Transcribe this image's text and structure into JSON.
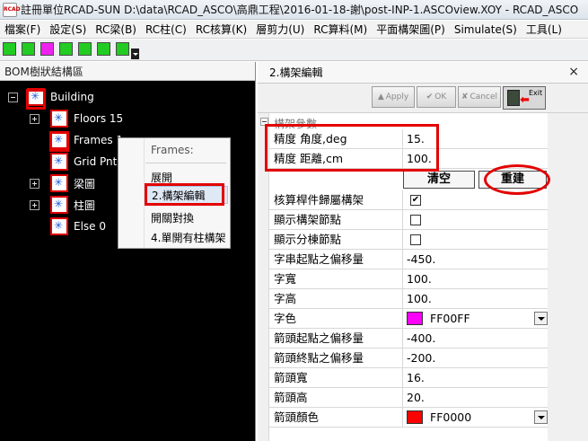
{
  "window": {
    "title": "註冊單位RCAD-SUN  D:\\data\\RCAD_ASCO\\高鼎工程\\2016-01-18-謝\\post-INP-1.ASCOview.XOY - RCAD_ASCO",
    "logo_text": "RCAD"
  },
  "menu": [
    {
      "label": "檔案(F)"
    },
    {
      "label": "設定(S)"
    },
    {
      "label": "RC梁(B)"
    },
    {
      "label": "RC柱(C)"
    },
    {
      "label": "RC核算(K)"
    },
    {
      "label": "層剪力(U)"
    },
    {
      "label": "RC算料(M)"
    },
    {
      "label": "平面構架圖(P)"
    },
    {
      "label": "Simulate(S)"
    },
    {
      "label": "工具(L)"
    }
  ],
  "toolbar": {
    "buttons": [
      {
        "icon": "green-square-icon",
        "color": "#22cc22"
      },
      {
        "icon": "green-square-icon",
        "color": "#22cc22"
      },
      {
        "icon": "magenta-square-icon",
        "color": "#ee22ee"
      },
      {
        "icon": "cube-icon",
        "color": "#22cc22"
      },
      {
        "icon": "cycle-icon",
        "color": "#22cc22"
      },
      {
        "icon": "arrow-icon",
        "color": "#22cc22"
      },
      {
        "icon": "grid-icon",
        "color": "#22cc22"
      }
    ]
  },
  "left_panel": {
    "title": "BOM樹狀結構區",
    "tree": [
      {
        "label": "Building",
        "expander": "minus"
      },
      {
        "label": "Floors 15",
        "expander": "plus"
      },
      {
        "label": "Frames 1",
        "expander": ""
      },
      {
        "label": "Grid Pnt",
        "expander": ""
      },
      {
        "label": "梁圖",
        "expander": "plus"
      },
      {
        "label": "柱圖",
        "expander": "plus"
      },
      {
        "label": "Else 0",
        "expander": ""
      }
    ],
    "context_menu": {
      "title": "Frames:",
      "items": [
        {
          "label": "展開"
        },
        {
          "label": "2.構架編輯"
        },
        {
          "label": "開關對換"
        },
        {
          "label": "4.單開有柱構架"
        }
      ]
    }
  },
  "right_panel": {
    "title": "2.構架編輯",
    "close": "×",
    "buttons": {
      "apply": "Apply",
      "ok": "OK",
      "cancel": "Cancel",
      "exit": "Exit"
    },
    "group_label": "構架參數",
    "precision": [
      {
        "name": "精度 角度,deg",
        "value": "15."
      },
      {
        "name": "精度 距離,cm",
        "value": "100."
      }
    ],
    "clear_label": "清空",
    "rebuild_label": "重建",
    "properties": [
      {
        "name": "核算桿件歸屬構架",
        "type": "check",
        "checked": true
      },
      {
        "name": "顯示構架節點",
        "type": "check",
        "checked": false
      },
      {
        "name": "顯示分棟節點",
        "type": "check",
        "checked": false
      },
      {
        "name": "字串起點之偏移量",
        "type": "text",
        "value": "-450."
      },
      {
        "name": "字寬",
        "type": "text",
        "value": "100."
      },
      {
        "name": "字高",
        "type": "text",
        "value": "100."
      },
      {
        "name": "字色",
        "type": "color",
        "value": "FF00FF",
        "color": "#ff00ff"
      },
      {
        "name": "箭頭起點之偏移量",
        "type": "text",
        "value": "-400."
      },
      {
        "name": "箭頭終點之偏移量",
        "type": "text",
        "value": "-200."
      },
      {
        "name": "箭頭寬",
        "type": "text",
        "value": "16."
      },
      {
        "name": "箭頭高",
        "type": "text",
        "value": "20."
      },
      {
        "name": "箭頭顏色",
        "type": "color",
        "value": "FF0000",
        "color": "#ff0000"
      }
    ]
  }
}
